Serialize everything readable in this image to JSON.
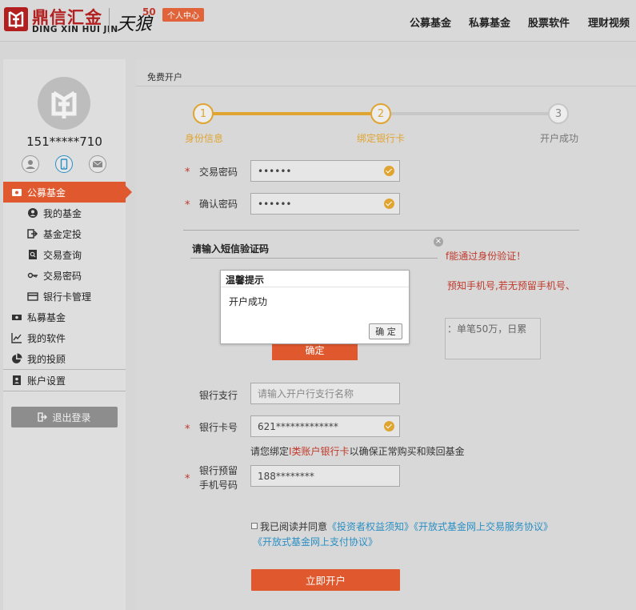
{
  "header": {
    "brand_cn": "鼎信汇金",
    "brand_en": "DING XIN HUI JIN",
    "partner_logo": "天狼",
    "partner_number": "50",
    "personal_center": "个人中心",
    "nav": [
      "公募基金",
      "私募基金",
      "股票软件",
      "理财视频"
    ]
  },
  "sidebar": {
    "account": "151*****710",
    "contact_icons": [
      "user-icon",
      "phone-icon",
      "mail-icon"
    ],
    "menu": [
      {
        "label": "公募基金",
        "icon": "wallet-icon",
        "level": "top",
        "active": true
      },
      {
        "label": "我的基金",
        "icon": "user-circle-icon",
        "level": "sub"
      },
      {
        "label": "基金定投",
        "icon": "sign-in-icon",
        "level": "sub"
      },
      {
        "label": "交易查询",
        "icon": "search-doc-icon",
        "level": "sub"
      },
      {
        "label": "交易密码",
        "icon": "key-icon",
        "level": "sub"
      },
      {
        "label": "银行卡管理",
        "icon": "card-icon",
        "level": "sub"
      },
      {
        "label": "私募基金",
        "icon": "money-icon",
        "level": "top"
      },
      {
        "label": "我的软件",
        "icon": "chart-line-icon",
        "level": "top"
      },
      {
        "label": "我的投顾",
        "icon": "pie-chart-icon",
        "level": "top"
      },
      {
        "label": "账户设置",
        "icon": "id-card-icon",
        "level": "top"
      }
    ],
    "logout": "退出登录"
  },
  "main": {
    "breadcrumb": "免费开户",
    "steps": [
      {
        "num": "1",
        "label": "身份信息",
        "state": "done"
      },
      {
        "num": "2",
        "label": "绑定银行卡",
        "state": "current"
      },
      {
        "num": "3",
        "label": "开户成功",
        "state": "pending"
      }
    ],
    "trade_password": {
      "label": "交易密码",
      "value": "••••••"
    },
    "confirm_password": {
      "label": "确认密码",
      "value": "••••••"
    },
    "sms": {
      "title": "请输入短信验证码",
      "close": "×",
      "notice1": "f能通过身份验证！",
      "notice2": "预知手机号,若无预留手机号、",
      "limit_text": "：单笔50万，日累",
      "confirm": "确定"
    },
    "dialog": {
      "title": "温馨提示",
      "message": "开户成功",
      "ok": "确 定"
    },
    "bank_branch": {
      "label": "银行支行",
      "placeholder": "请输入开户行支行名称"
    },
    "bank_card": {
      "label": "银行卡号",
      "value": "621*************"
    },
    "card_hint_pre": "请您绑定",
    "card_hint_red": "I类账户银行卡",
    "card_hint_post": "以确保正常购买和赎回基金",
    "reserved_phone": {
      "label_line1": "银行预留",
      "label_line2": "手机号码",
      "value": "188********"
    },
    "agree": {
      "prefix": "我已阅读并同意",
      "link1": "《投资者权益须知》",
      "link2": "《开放式基金网上交易服务协议》",
      "link3": "《开放式基金网上支付协议》"
    },
    "submit": "立即开户"
  }
}
